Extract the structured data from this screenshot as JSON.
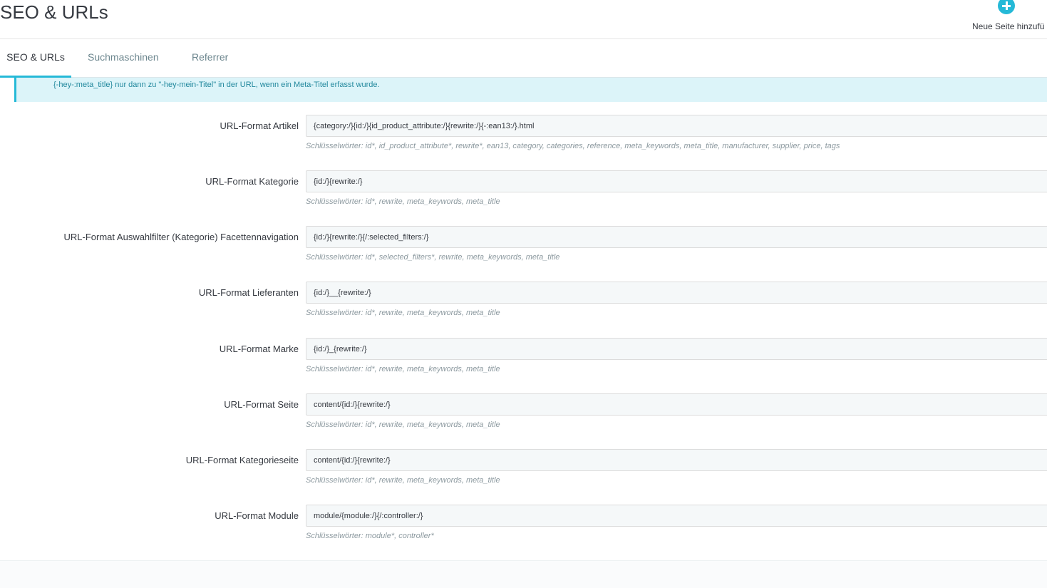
{
  "header": {
    "title": "SEO & URLs",
    "add_page_label": "Neue Seite hinzufü"
  },
  "tabs": [
    {
      "label": "SEO & URLs",
      "active": true
    },
    {
      "label": "Suchmaschinen",
      "active": false
    },
    {
      "label": "Referrer",
      "active": false
    }
  ],
  "alert": {
    "text": "{-hey-:meta_title} nur dann zu \"-hey-mein-Titel\" in der URL, wenn ein Meta-Titel erfasst wurde."
  },
  "fields": [
    {
      "label": "URL-Format Artikel",
      "value": "{category:/}{id:/}{id_product_attribute:/}{rewrite:/}{-:ean13:/}.html",
      "help": "Schlüsselwörter: id*, id_product_attribute*, rewrite*, ean13, category, categories, reference, meta_keywords, meta_title, manufacturer, supplier, price, tags"
    },
    {
      "label": "URL-Format Kategorie",
      "value": "{id:/}{rewrite:/}",
      "help": "Schlüsselwörter: id*, rewrite, meta_keywords, meta_title"
    },
    {
      "label": "URL-Format Auswahlfilter (Kategorie) Facettennavigation",
      "value": "{id:/}{rewrite:/}{/:selected_filters:/}",
      "help": "Schlüsselwörter: id*, selected_filters*, rewrite, meta_keywords, meta_title"
    },
    {
      "label": "URL-Format Lieferanten",
      "value": "{id:/}__{rewrite:/}",
      "help": "Schlüsselwörter: id*, rewrite, meta_keywords, meta_title"
    },
    {
      "label": "URL-Format Marke",
      "value": "{id:/}_{rewrite:/}",
      "help": "Schlüsselwörter: id*, rewrite, meta_keywords, meta_title"
    },
    {
      "label": "URL-Format Seite",
      "value": "content/{id:/}{rewrite:/}",
      "help": "Schlüsselwörter: id*, rewrite, meta_keywords, meta_title"
    },
    {
      "label": "URL-Format Kategorieseite",
      "value": "content/{id:/}{rewrite:/}",
      "help": "Schlüsselwörter: id*, rewrite, meta_keywords, meta_title"
    },
    {
      "label": "URL-Format Module",
      "value": "module/{module:/}{/:controller:/}",
      "help": "Schlüsselwörter: module*, controller*"
    }
  ],
  "colors": {
    "accent": "#25b9d7",
    "alert_bg": "#dcf4f9",
    "alert_text": "#22889d",
    "input_bg": "#f5f8f9",
    "help_text": "#8d9aa0"
  },
  "icons": {
    "add_page": "plus-circle-icon"
  }
}
